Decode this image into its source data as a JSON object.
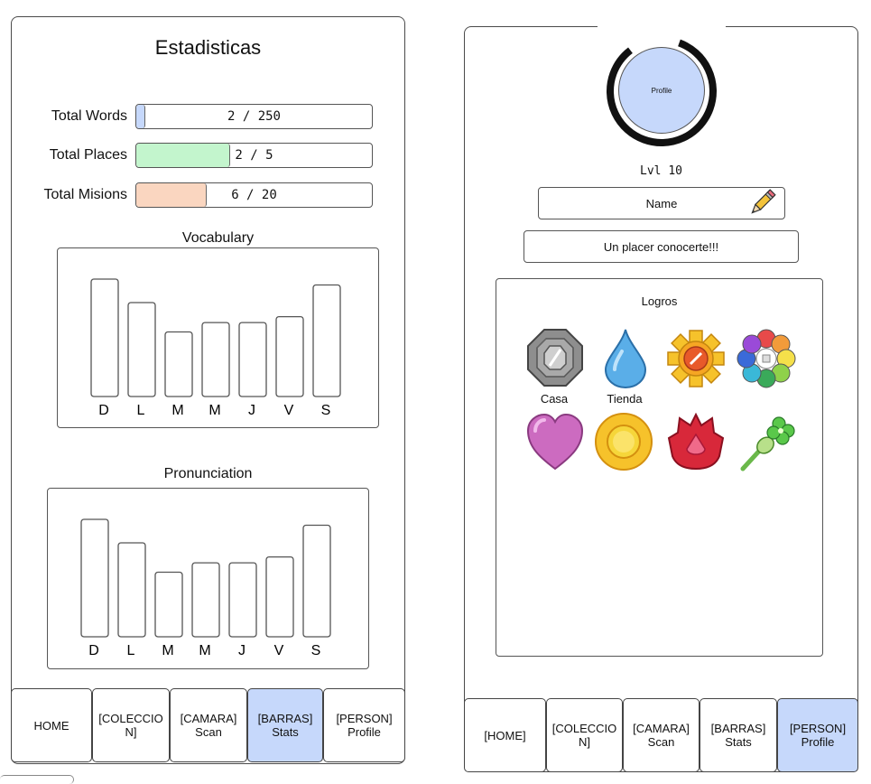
{
  "stats_screen": {
    "title": "Estadisticas",
    "stats": [
      {
        "label": "Total Words",
        "text": "2 / 250",
        "value": 2,
        "max": 250,
        "color": "#c6d8fb"
      },
      {
        "label": "Total Places",
        "text": "2 / 5",
        "value": 2,
        "max": 5,
        "color": "#c3f5cd"
      },
      {
        "label": "Total Misions",
        "text": "6 / 20",
        "value": 6,
        "max": 20,
        "color": "#fad6c0"
      }
    ],
    "vocabulary_title": "Vocabulary",
    "pronunciation_title": "Pronunciation",
    "nav": [
      {
        "label": "HOME",
        "active": false
      },
      {
        "label": "[COLECCIO N]",
        "active": false
      },
      {
        "label": "[CAMARA] Scan",
        "active": false
      },
      {
        "label": "[BARRAS] Stats",
        "active": true
      },
      {
        "label": "[PERSON] Profile",
        "active": false
      }
    ]
  },
  "chart_data": [
    {
      "type": "bar",
      "title": "Vocabulary",
      "categories": [
        "D",
        "L",
        "M",
        "M",
        "J",
        "V",
        "S"
      ],
      "values": [
        100,
        80,
        55,
        63,
        63,
        68,
        95
      ],
      "ylim": [
        0,
        100
      ]
    },
    {
      "type": "bar",
      "title": "Pronunciation",
      "categories": [
        "D",
        "L",
        "M",
        "M",
        "J",
        "V",
        "S"
      ],
      "values": [
        100,
        80,
        55,
        63,
        63,
        68,
        95
      ],
      "ylim": [
        0,
        100
      ]
    }
  ],
  "profile_screen": {
    "avatar_label": "Profile",
    "progress_ring_fraction": 0.84,
    "level": "Lvl 10",
    "name": "Name",
    "greeting": "Un placer conocerte!!!",
    "achievements_title": "Logros",
    "badges": [
      {
        "name": "boulder-badge-icon",
        "label": "Casa"
      },
      {
        "name": "cascade-badge-icon",
        "label": "Tienda"
      },
      {
        "name": "thunder-badge-icon",
        "label": ""
      },
      {
        "name": "rainbow-badge-icon",
        "label": ""
      },
      {
        "name": "soul-badge-icon",
        "label": ""
      },
      {
        "name": "marsh-badge-icon",
        "label": ""
      },
      {
        "name": "volcano-badge-icon",
        "label": ""
      },
      {
        "name": "earth-badge-icon",
        "label": ""
      }
    ],
    "nav": [
      {
        "label": "[HOME]",
        "active": false
      },
      {
        "label": "[COLECCIO N]",
        "active": false
      },
      {
        "label": "[CAMARA] Scan",
        "active": false
      },
      {
        "label": "[BARRAS] Stats",
        "active": false
      },
      {
        "label": "[PERSON] Profile",
        "active": true
      }
    ]
  }
}
